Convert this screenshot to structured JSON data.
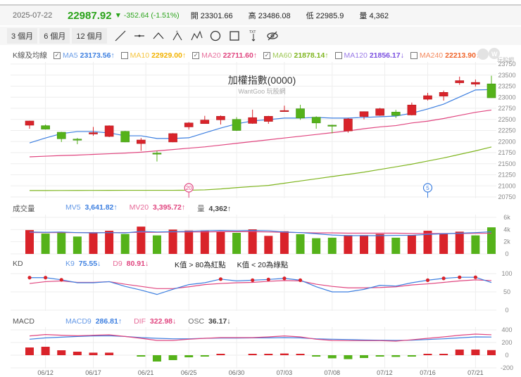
{
  "quote": {
    "date": "2025-07-22",
    "price": "22987.92",
    "change": "-352.64 (-1.51%)",
    "open_label": "開",
    "open": "23301.66",
    "high_label": "高",
    "high": "23486.08",
    "low_label": "低",
    "low": "22985.9",
    "vol_label": "量",
    "vol": "4,362"
  },
  "toolbar": {
    "ranges": [
      "3 個月",
      "6 個月",
      "12 個月"
    ],
    "tools": [
      "line-tool-icon",
      "horizontal-line-icon",
      "angle-line-icon",
      "abc-pattern-icon",
      "abcd-pattern-icon",
      "circle-tool-icon",
      "rectangle-tool-icon",
      "text-tool-icon",
      "hide-drawings-icon"
    ],
    "text_icon_label": "TXT"
  },
  "ma_legend": {
    "label": "K線及均線",
    "items": [
      {
        "name": "MA5",
        "value": "23173.56",
        "arrow": "↑",
        "checked": true,
        "color": "#3d7fe0"
      },
      {
        "name": "MA10",
        "value": "22929.00",
        "arrow": "↑",
        "checked": false,
        "color": "#f2b200"
      },
      {
        "name": "MA20",
        "value": "22711.60",
        "arrow": "↑",
        "checked": true,
        "color": "#e0457f"
      },
      {
        "name": "MA60",
        "value": "21878.14",
        "arrow": "↑",
        "checked": true,
        "color": "#7fb51f"
      },
      {
        "name": "MA120",
        "value": "21856.17",
        "arrow": "↓",
        "checked": false,
        "color": "#7a4fe0"
      },
      {
        "name": "MA240",
        "value": "22213.90",
        "arrow": "↑",
        "checked": false,
        "color": "#f0642a"
      }
    ]
  },
  "logo_text": "玩股網",
  "main": {
    "title": "加權指數(0000)",
    "subtitle": "WantGoo 玩股網",
    "yticks": [
      "23750",
      "23500",
      "23250",
      "23000",
      "22750",
      "22500",
      "22250",
      "22000",
      "21750",
      "21500",
      "21250",
      "21000",
      "20750"
    ],
    "markers": [
      {
        "label": "20",
        "candle": 11,
        "color": "#e0457f"
      },
      {
        "label": "5",
        "candle": 26,
        "color": "#3d7fe0"
      }
    ]
  },
  "colors": {
    "up": "#d9232a",
    "down": "#55b21a",
    "grid": "#eeeeee"
  },
  "chart_data": [
    {
      "type": "candlestick",
      "ylim": [
        20750,
        23750
      ],
      "ohlc": [
        [
          22369,
          22470,
          22290,
          22464
        ],
        [
          22358,
          22385,
          22270,
          22280
        ],
        [
          22210,
          22220,
          21990,
          22063
        ],
        [
          22055,
          22080,
          21940,
          22045
        ],
        [
          22170,
          22330,
          22130,
          22200
        ],
        [
          22115,
          22365,
          22100,
          22355
        ],
        [
          22230,
          22240,
          21985,
          21990
        ],
        [
          21955,
          22080,
          21790,
          22035
        ],
        [
          21740,
          21790,
          21550,
          21730
        ],
        [
          21990,
          22190,
          21985,
          22180
        ],
        [
          22330,
          22440,
          22270,
          22420
        ],
        [
          22405,
          22580,
          22400,
          22485
        ],
        [
          22490,
          22590,
          22385,
          22570
        ],
        [
          22500,
          22550,
          22240,
          22250
        ],
        [
          22410,
          22720,
          22400,
          22540
        ],
        [
          22455,
          22580,
          22400,
          22570
        ],
        [
          22690,
          22810,
          22690,
          22700
        ],
        [
          22740,
          22830,
          22490,
          22530
        ],
        [
          22550,
          22570,
          22290,
          22420
        ],
        [
          22370,
          22380,
          22185,
          22350
        ],
        [
          22240,
          22530,
          22200,
          22510
        ],
        [
          22565,
          22680,
          22500,
          22675
        ],
        [
          22590,
          22760,
          22580,
          22740
        ],
        [
          22665,
          22715,
          22530,
          22590
        ],
        [
          22600,
          22880,
          22590,
          22825
        ],
        [
          22955,
          23100,
          22925,
          23035
        ],
        [
          23025,
          23150,
          22925,
          23110
        ],
        [
          23325,
          23465,
          23280,
          23375
        ],
        [
          23295,
          23400,
          23240,
          23335
        ],
        [
          23301.66,
          23486.08,
          22985.9,
          22987.92
        ]
      ],
      "ma5": [
        21970,
        22080,
        22180,
        22225,
        22225,
        22195,
        22130,
        22130,
        22070,
        22070,
        22085,
        22195,
        22305,
        22400,
        22465,
        22495,
        22530,
        22530,
        22545,
        22530,
        22530,
        22545,
        22560,
        22575,
        22640,
        22735,
        22845,
        23005,
        23165,
        23173.56
      ],
      "ma20": [
        21655,
        21670,
        21685,
        21695,
        21710,
        21725,
        21740,
        21760,
        21790,
        21820,
        21850,
        21880,
        21920,
        21960,
        22000,
        22040,
        22080,
        22120,
        22160,
        22200,
        22240,
        22290,
        22330,
        22360,
        22420,
        22460,
        22520,
        22590,
        22660,
        22711.6
      ],
      "ma60": [
        20895,
        20895,
        20896,
        20897,
        20898,
        20899,
        20900,
        20900,
        20900,
        20900,
        20902,
        20910,
        20930,
        20960,
        20985,
        21010,
        21060,
        21110,
        21160,
        21210,
        21260,
        21310,
        21370,
        21430,
        21490,
        21560,
        21630,
        21710,
        21790,
        21878.14
      ]
    },
    {
      "type": "bar",
      "title": "成交量",
      "yticks": [
        "6k",
        "4k",
        "2k",
        "0"
      ],
      "ylim": [
        0,
        6
      ],
      "values": [
        3.91,
        3.34,
        3.61,
        2.85,
        3.53,
        3.8,
        3.27,
        4.48,
        3.04,
        3.99,
        3.84,
        3.84,
        3.65,
        3.46,
        4.03,
        2.96,
        3.72,
        3.23,
        2.58,
        2.66,
        3.08,
        3.08,
        3.27,
        2.66,
        3.08,
        3.8,
        3.34,
        3.65,
        3.04,
        4.362
      ],
      "up": [
        1,
        0,
        0,
        0,
        1,
        1,
        0,
        1,
        0,
        1,
        1,
        1,
        1,
        0,
        1,
        1,
        1,
        0,
        0,
        0,
        1,
        1,
        1,
        0,
        1,
        1,
        1,
        1,
        0,
        0
      ],
      "mv5": [
        3.6,
        3.55,
        3.6,
        3.5,
        3.45,
        3.5,
        3.45,
        3.7,
        3.6,
        3.65,
        3.7,
        3.8,
        3.85,
        3.8,
        3.85,
        3.8,
        3.6,
        3.5,
        3.3,
        3.1,
        3.0,
        3.0,
        3.0,
        3.05,
        3.05,
        3.2,
        3.3,
        3.4,
        3.5,
        3.64182
      ],
      "mv20": [
        3.5,
        3.5,
        3.5,
        3.5,
        3.5,
        3.5,
        3.5,
        3.55,
        3.55,
        3.6,
        3.6,
        3.6,
        3.65,
        3.65,
        3.65,
        3.6,
        3.55,
        3.5,
        3.45,
        3.45,
        3.4,
        3.4,
        3.4,
        3.4,
        3.35,
        3.35,
        3.35,
        3.35,
        3.38,
        3.39572
      ],
      "legend": [
        {
          "name": "MV5",
          "value": "3,641.82",
          "arrow": "↑",
          "color": "#3d7fe0"
        },
        {
          "name": "MV20",
          "value": "3,395.72",
          "arrow": "↑",
          "color": "#e0457f"
        },
        {
          "name": "量",
          "value": "4,362",
          "arrow": "↑",
          "color": "#444"
        }
      ]
    },
    {
      "type": "line",
      "title": "KD",
      "yticks": [
        "100",
        "50",
        "0"
      ],
      "ylim": [
        0,
        100
      ],
      "k": [
        89,
        89,
        83,
        75,
        75,
        78,
        65,
        55,
        43,
        57,
        70,
        75,
        85,
        80,
        82,
        84,
        87,
        82,
        64,
        50,
        50,
        57,
        68,
        66,
        75,
        82,
        87,
        90,
        90,
        75.55
      ],
      "d": [
        73,
        78,
        80,
        76,
        76,
        78,
        71,
        65,
        59,
        59,
        64,
        70,
        73,
        75,
        76,
        79,
        81,
        80,
        71,
        65,
        61,
        61,
        62,
        64,
        69,
        72,
        76,
        80,
        83,
        80.91
      ],
      "legend": [
        {
          "name": "K9",
          "value": "75.55",
          "arrow": "↓",
          "color": "#3d7fe0"
        },
        {
          "name": "D9",
          "value": "80.91",
          "arrow": "↓",
          "color": "#e0457f"
        }
      ],
      "notes": [
        "K值 > 80為紅點",
        "K值 < 20為綠點"
      ]
    },
    {
      "type": "line",
      "title": "MACD",
      "yticks": [
        "400",
        "200",
        "0",
        "-200"
      ],
      "ylim": [
        -200,
        400
      ],
      "dif": [
        304,
        326,
        315,
        307,
        315,
        322,
        296,
        267,
        233,
        233,
        252,
        267,
        278,
        278,
        278,
        289,
        304,
        289,
        252,
        233,
        230,
        230,
        230,
        222,
        244,
        267,
        289,
        315,
        333,
        322.98
      ],
      "macd9": [
        252,
        274,
        285,
        296,
        304,
        307,
        296,
        278,
        267,
        259,
        259,
        267,
        270,
        270,
        274,
        274,
        278,
        274,
        259,
        252,
        248,
        240,
        237,
        233,
        237,
        248,
        259,
        274,
        289,
        286.81
      ],
      "osc": [
        55,
        60,
        35,
        25,
        18,
        18,
        0,
        -10,
        -45,
        -35,
        -15,
        -5,
        5,
        0,
        5,
        5,
        12,
        5,
        -5,
        -22,
        -28,
        -20,
        -8,
        -12,
        -8,
        5,
        10,
        40,
        40,
        36.17
      ],
      "legend": [
        {
          "name": "MACD9",
          "value": "286.81",
          "arrow": "↑",
          "color": "#3d7fe0"
        },
        {
          "name": "DIF",
          "value": "322.98",
          "arrow": "↓",
          "color": "#e0457f"
        },
        {
          "name": "OSC",
          "value": "36.17",
          "arrow": "↓",
          "color": "#444"
        }
      ],
      "xticks": [
        "06/12",
        "06/17",
        "06/21",
        "06/25",
        "06/30",
        "07/03",
        "07/08",
        "07/12",
        "07/16",
        "07/21"
      ]
    }
  ]
}
